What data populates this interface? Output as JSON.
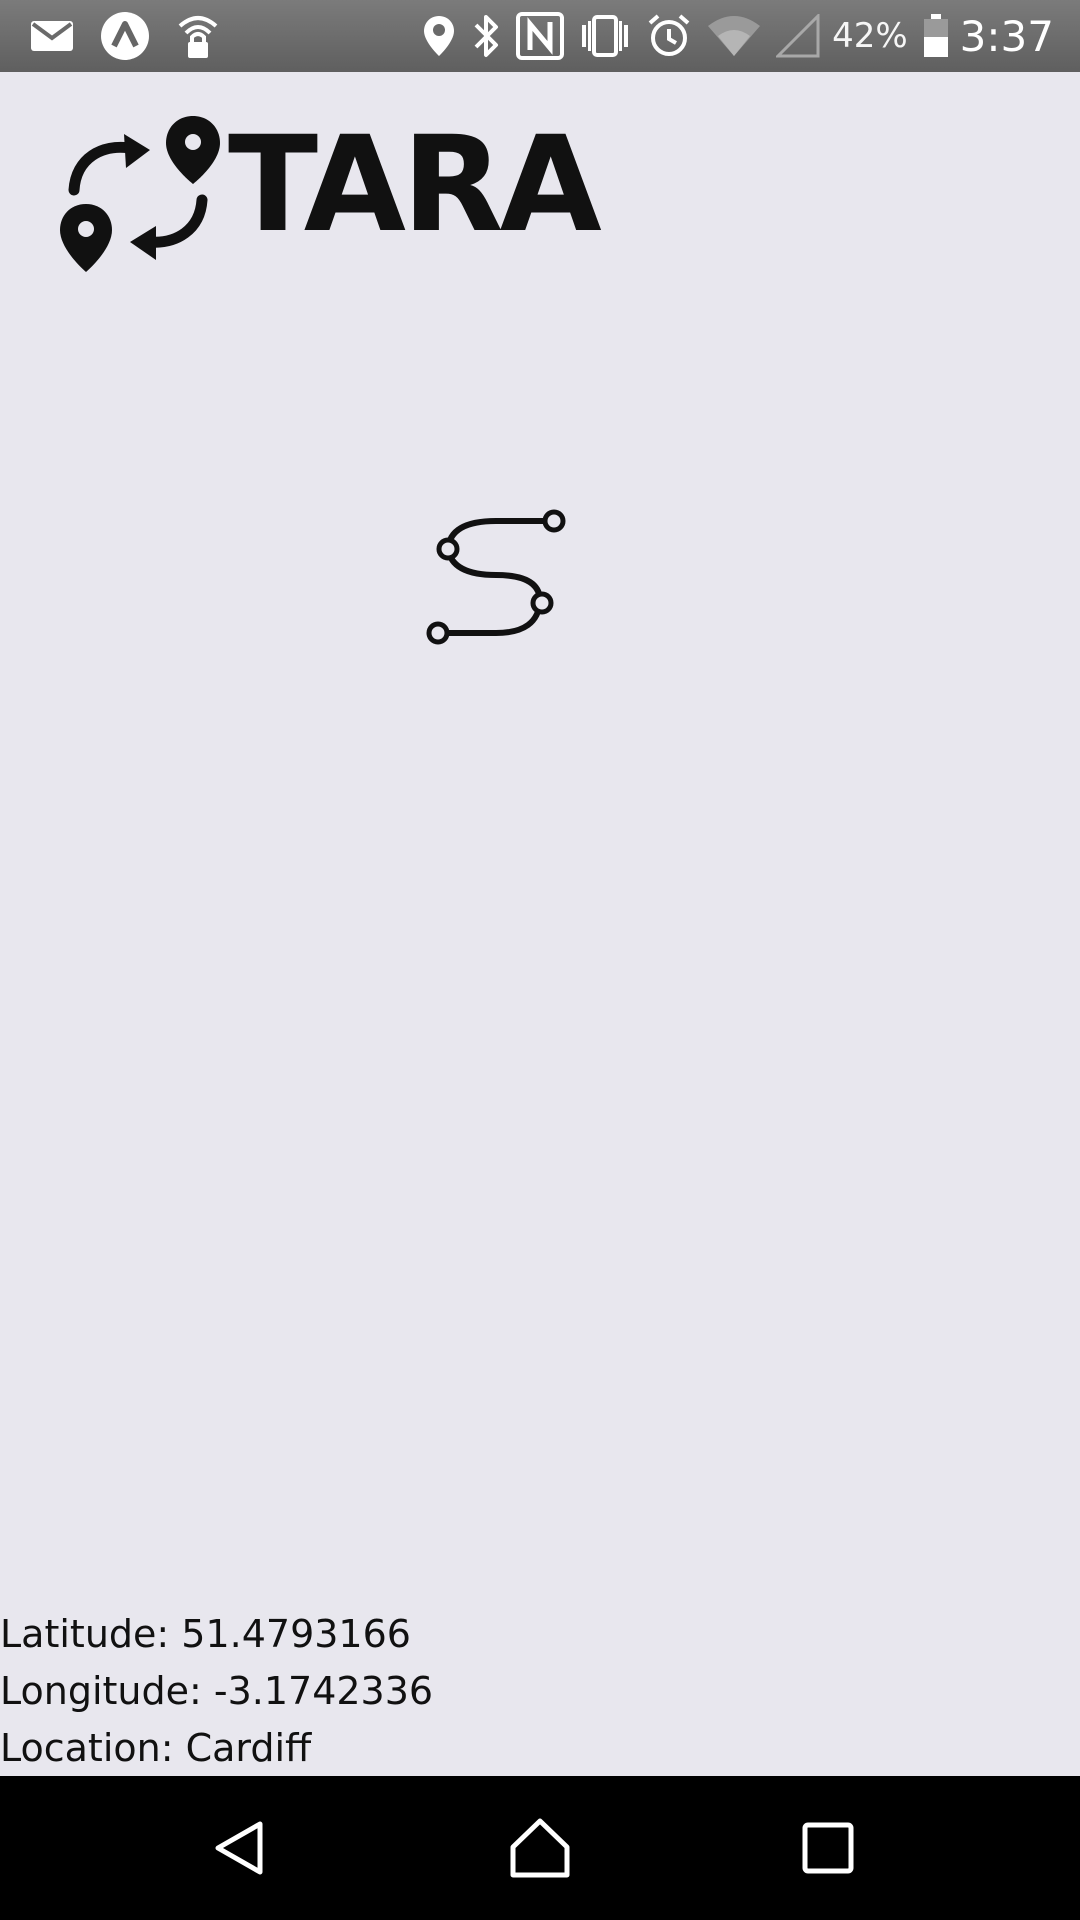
{
  "status_bar": {
    "left_icons": [
      "gmail-icon",
      "app-notification-icon",
      "wifi-lock-icon"
    ],
    "right_icons": [
      "location-pin-icon",
      "bluetooth-icon",
      "nfc-icon",
      "vibrate-icon",
      "alarm-icon",
      "wifi-icon",
      "cell-signal-icon",
      "battery-icon"
    ],
    "battery_percent": "42%",
    "battery_level": 0.42,
    "time": "3:37"
  },
  "app": {
    "logo_text": "TARA",
    "logo_icon": "route-swap-pins-icon",
    "center_icon": "route-icon"
  },
  "location": {
    "latitude_line": "Latitude: 51.4793166",
    "longitude_line": "Longitude: -3.1742336",
    "location_line": "Location: Cardiff"
  },
  "nav_bar": {
    "buttons": [
      "back-icon",
      "home-icon",
      "recents-icon"
    ]
  },
  "colors": {
    "background": "#e8e7ee",
    "status_bar": "#6c6c6c",
    "nav_bar": "#000000",
    "text": "#111111"
  }
}
